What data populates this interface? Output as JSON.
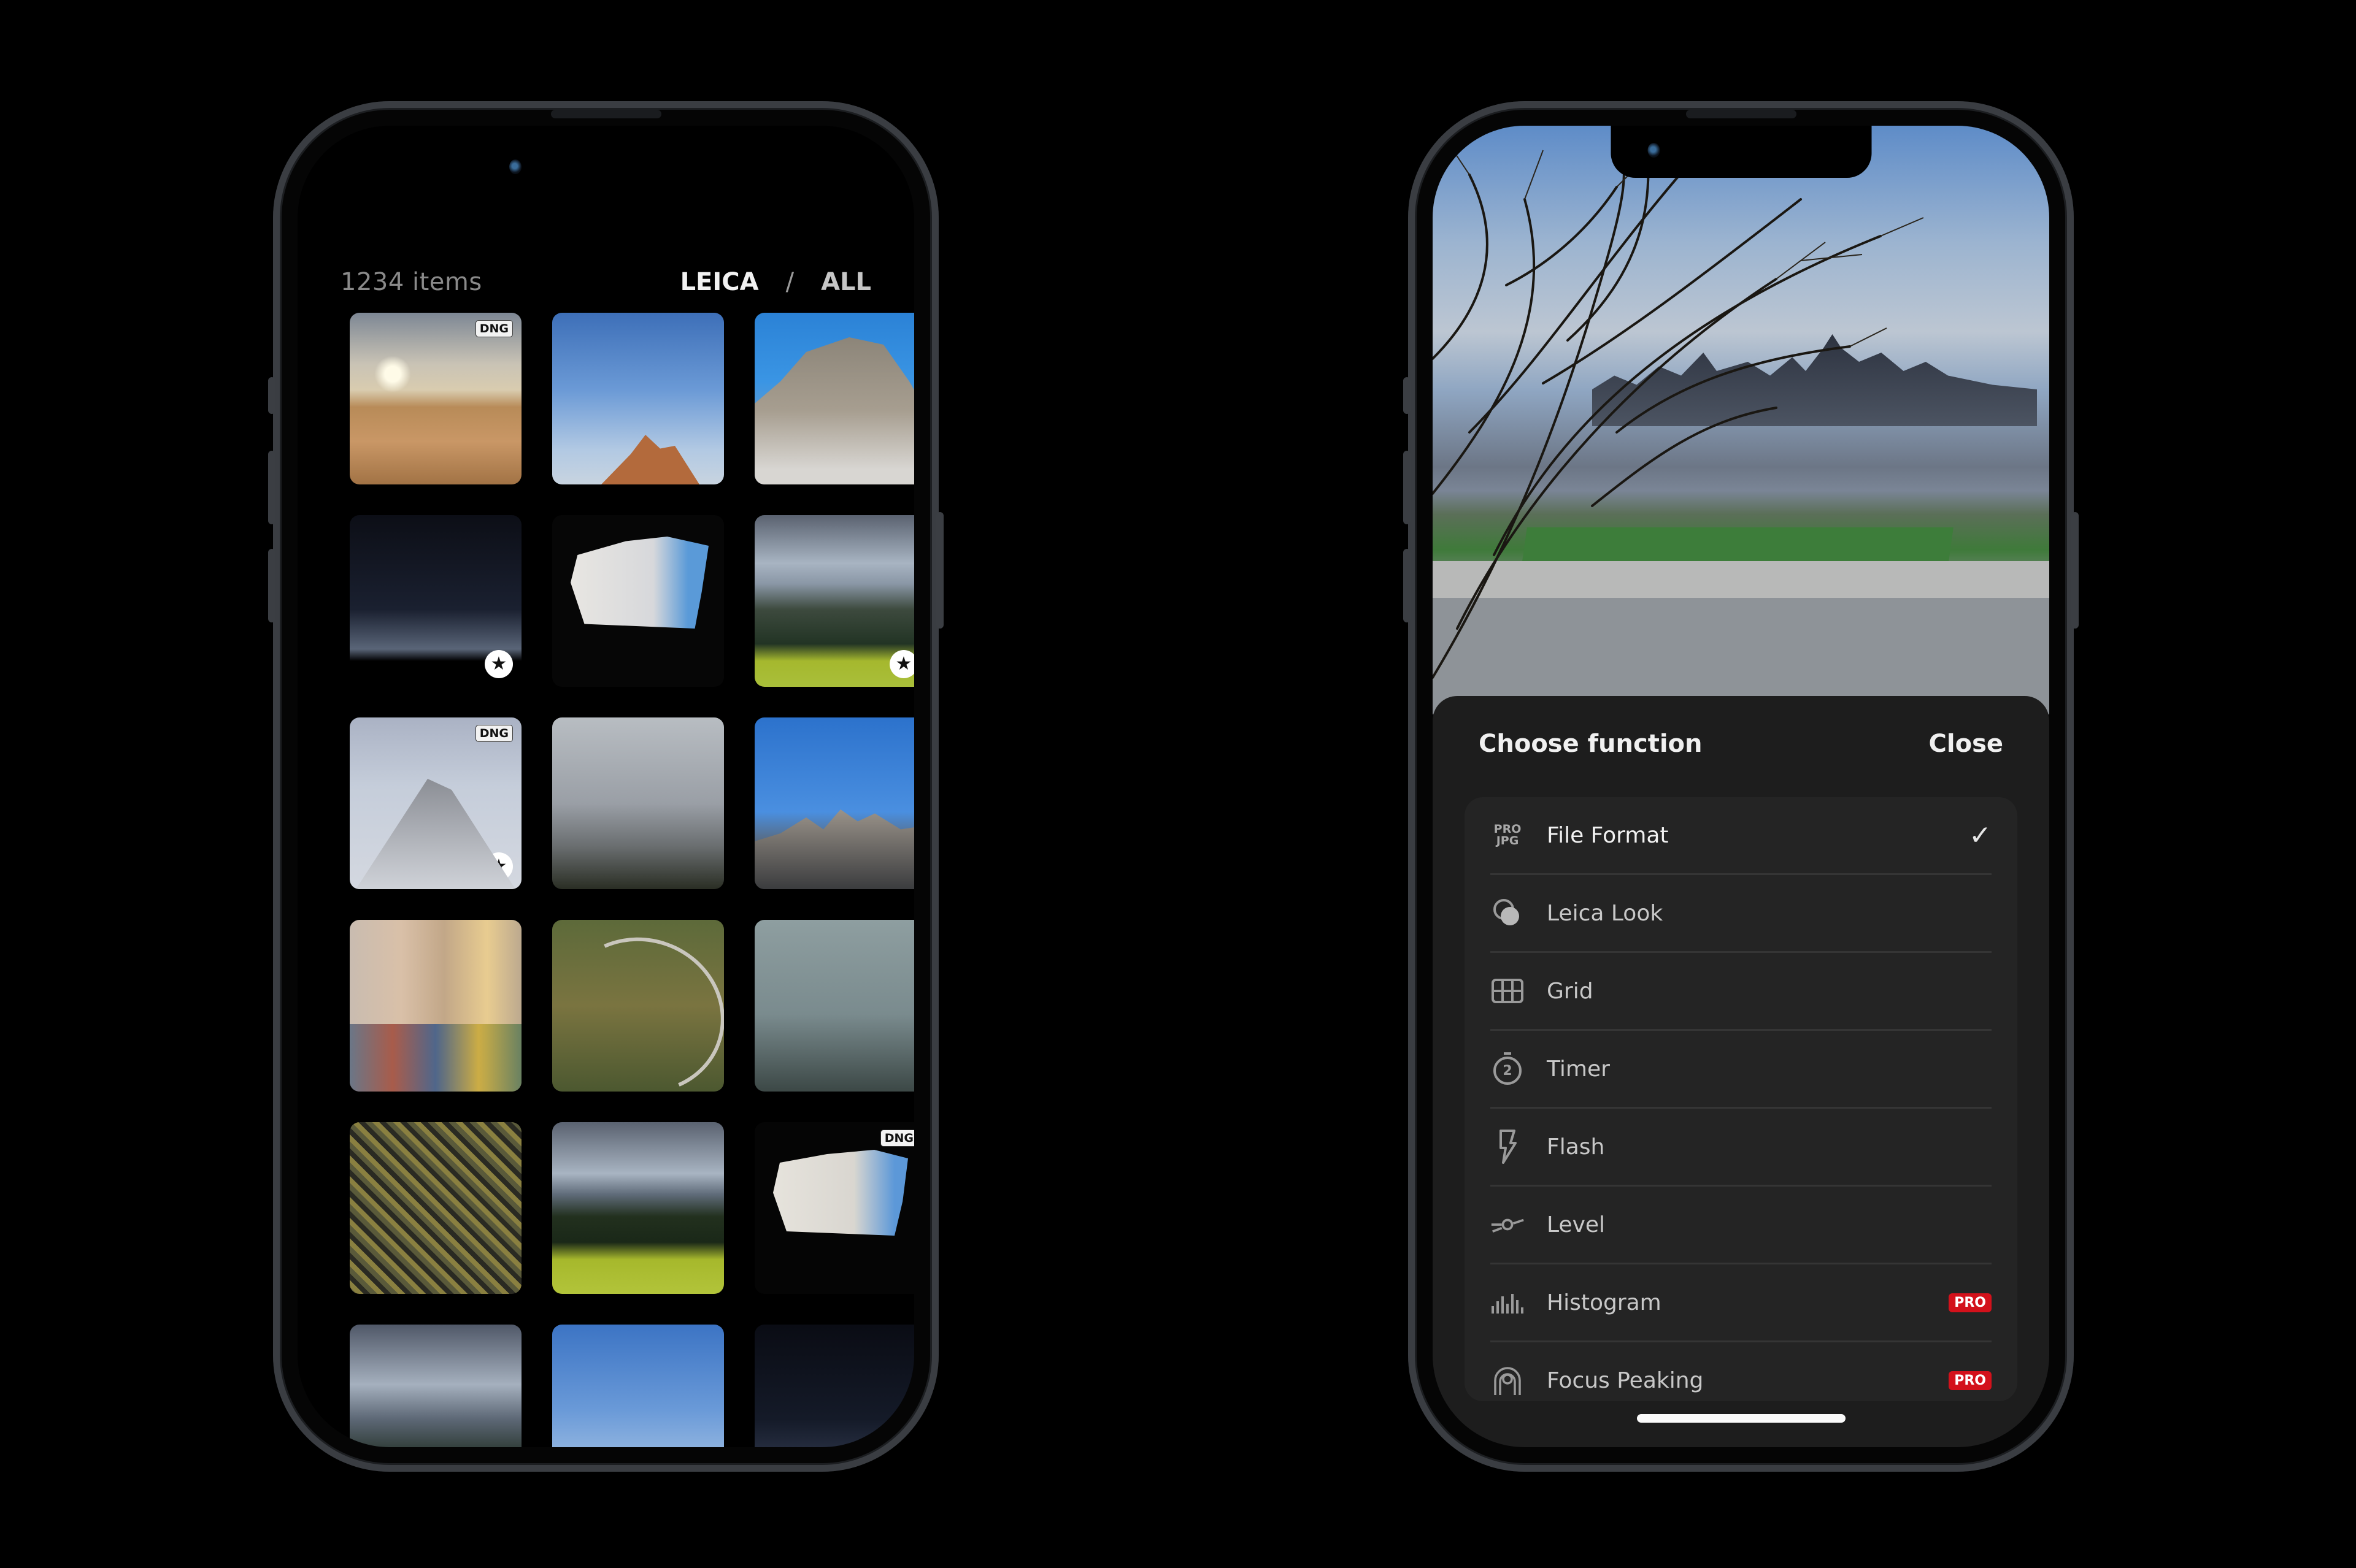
{
  "gallery_screen": {
    "item_count": "1234 items",
    "filters": {
      "leica": "LEICA",
      "separator": "/",
      "all": "ALL"
    },
    "thumbnails": [
      {
        "subject": "desert-dunes",
        "badge": "DNG",
        "favorite": false
      },
      {
        "subject": "sky-sunlit-peak",
        "badge": "",
        "favorite": false
      },
      {
        "subject": "rock-mountain",
        "badge": "",
        "favorite": false
      },
      {
        "subject": "night-ridge",
        "badge": "",
        "favorite": true
      },
      {
        "subject": "cave-view",
        "badge": "",
        "favorite": false
      },
      {
        "subject": "alpine-meadow",
        "badge": "",
        "favorite": true
      },
      {
        "subject": "snow-peak",
        "badge": "DNG",
        "favorite": true
      },
      {
        "subject": "foggy-peaks",
        "badge": "",
        "favorite": false
      },
      {
        "subject": "jagged-ridge",
        "badge": "",
        "favorite": false
      },
      {
        "subject": "city-street",
        "badge": "",
        "favorite": false
      },
      {
        "subject": "winding-road",
        "badge": "",
        "favorite": false
      },
      {
        "subject": "misty-forest",
        "badge": "",
        "favorite": false
      },
      {
        "subject": "mossy-rocks",
        "badge": "",
        "favorite": false
      },
      {
        "subject": "green-valley",
        "badge": "",
        "favorite": false
      },
      {
        "subject": "cave-view-2",
        "badge": "DNG",
        "favorite": false
      },
      {
        "subject": "mountain-valley",
        "badge": "",
        "favorite": false
      },
      {
        "subject": "blue-sky",
        "badge": "",
        "favorite": false
      },
      {
        "subject": "dark-gradient",
        "badge": "",
        "favorite": false
      }
    ],
    "star_glyph": "★"
  },
  "function_screen": {
    "photo_subject": "city-skyline-through-branches",
    "title": "Choose function",
    "close_label": "Close",
    "items": [
      {
        "label": "File Format",
        "icon": "pro-jpg-icon",
        "icon_text_top": "PRO",
        "icon_text_bottom": "JPG",
        "selected": true,
        "check": "✓",
        "badge": ""
      },
      {
        "label": "Leica Look",
        "icon": "leica-look-icon",
        "selected": false,
        "badge": ""
      },
      {
        "label": "Grid",
        "icon": "grid-icon",
        "selected": false,
        "badge": ""
      },
      {
        "label": "Timer",
        "icon": "timer-icon",
        "timer_value": "2",
        "selected": false,
        "badge": ""
      },
      {
        "label": "Flash",
        "icon": "flash-icon",
        "selected": false,
        "badge": ""
      },
      {
        "label": "Level",
        "icon": "level-icon",
        "selected": false,
        "badge": ""
      },
      {
        "label": "Histogram",
        "icon": "histogram-icon",
        "selected": false,
        "badge": "PRO"
      },
      {
        "label": "Focus Peaking",
        "icon": "focus-peaking-icon",
        "selected": false,
        "badge": "PRO"
      }
    ],
    "accent_color": "#d3111b"
  }
}
